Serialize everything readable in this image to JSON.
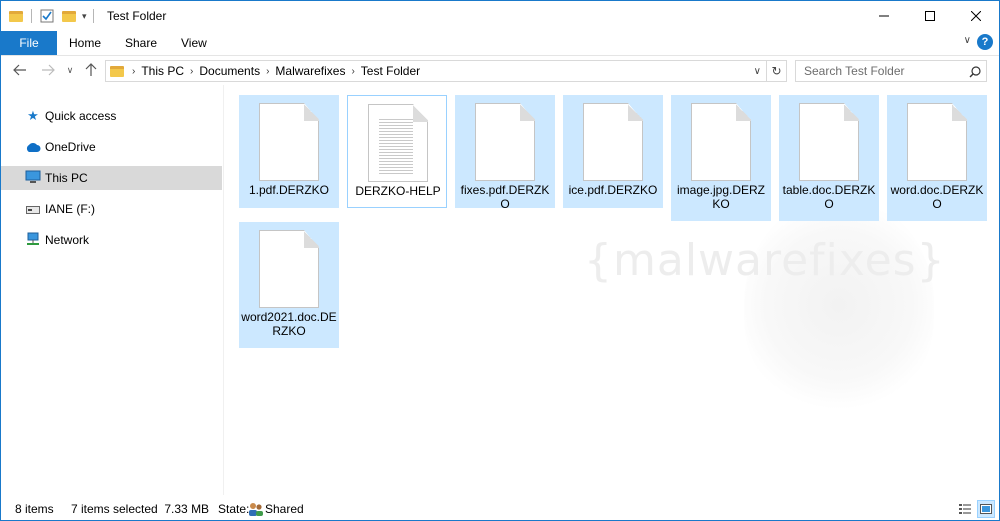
{
  "window": {
    "title": "Test Folder"
  },
  "ribbon": {
    "file": "File",
    "tabs": [
      "Home",
      "Share",
      "View"
    ],
    "help": "?"
  },
  "address": {
    "crumbs": [
      "This PC",
      "Documents",
      "Malwarefixes",
      "Test Folder"
    ],
    "search_placeholder": "Search Test Folder"
  },
  "nav": {
    "items": [
      {
        "label": "Quick access",
        "icon": "star-icon"
      },
      {
        "label": "OneDrive",
        "icon": "cloud-icon"
      },
      {
        "label": "This PC",
        "icon": "computer-icon",
        "selected": true
      },
      {
        "label": "IANE (F:)",
        "icon": "drive-icon"
      },
      {
        "label": "Network",
        "icon": "network-icon"
      }
    ]
  },
  "files": [
    {
      "name": "1.pdf.DERZKO",
      "selected": true
    },
    {
      "name": "DERZKO-HELP",
      "selected": false,
      "type": "text"
    },
    {
      "name": "fixes.pdf.DERZKO",
      "selected": true
    },
    {
      "name": "ice.pdf.DERZKO",
      "selected": true
    },
    {
      "name": "image.jpg.DERZKO",
      "selected": true
    },
    {
      "name": "table.doc.DERZKO",
      "selected": true
    },
    {
      "name": "word.doc.DERZKO",
      "selected": true
    },
    {
      "name": "word2021.doc.DERZKO",
      "selected": true
    }
  ],
  "watermark": "{malwarefixes}",
  "status": {
    "items": "8 items",
    "selected": "7 items selected  7.33 MB",
    "state_label": "State:",
    "state_value": "Shared"
  },
  "colors": {
    "accent": "#1979ca",
    "selection": "#cce8ff",
    "nav_selected": "#d9d9d9"
  }
}
